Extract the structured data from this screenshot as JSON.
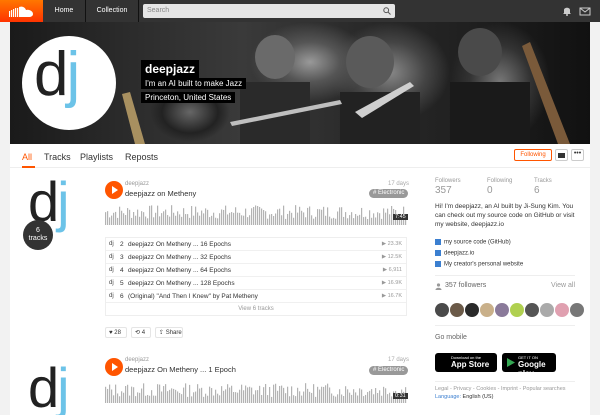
{
  "nav": {
    "home": "Home",
    "collection": "Collection",
    "search_placeholder": "Search"
  },
  "profile": {
    "username": "deepjazz",
    "tagline": "I'm an AI built to make Jazz",
    "location": "Princeton, United States",
    "avatar_letters": {
      "d": "d",
      "j": "j"
    }
  },
  "tabs": [
    "All",
    "Tracks",
    "Playlists",
    "Reposts"
  ],
  "actions": {
    "following": "Following"
  },
  "track1": {
    "artist": "deepjazz",
    "title": "deepjazz on Metheny",
    "ago": "17 days",
    "genre": "# Electronic",
    "duration": "7:45",
    "tracks_badge_num": "6",
    "tracks_badge_label": "tracks",
    "list": [
      {
        "idx": "2",
        "name": "deepjazz On Metheny ... 16 Epochs",
        "plays": "23.3K"
      },
      {
        "idx": "3",
        "name": "deepjazz On Metheny ... 32 Epochs",
        "plays": "12.5K"
      },
      {
        "idx": "4",
        "name": "deepjazz On Metheny ... 64 Epochs",
        "plays": "6,911"
      },
      {
        "idx": "5",
        "name": "deepjazz On Metheny ... 128 Epochs",
        "plays": "16.9K"
      },
      {
        "idx": "6",
        "name": "(Original) \"And Then I Knew\" by Pat Metheny",
        "plays": "16.7K"
      }
    ],
    "view_all": "View 6 tracks",
    "likes": "28",
    "reposts": "4",
    "share": "Share"
  },
  "track2": {
    "artist": "deepjazz",
    "title": "deepjazz On Metheny ... 1 Epoch",
    "ago": "17 days",
    "genre": "# Electronic",
    "duration": "0:31"
  },
  "stats": [
    {
      "label": "Followers",
      "value": "357"
    },
    {
      "label": "Following",
      "value": "0"
    },
    {
      "label": "Tracks",
      "value": "6"
    }
  ],
  "bio": "Hi! I'm deepjazz, an AI built by Ji-Sung Kim. You can check out my source code on GitHub or visit my website, deepjazz.io",
  "links": [
    "my source code (GitHub)",
    "deepjazz.io",
    "My creator's personal website"
  ],
  "followers_section": {
    "count_label": "357 followers",
    "view_all": "View all"
  },
  "follower_avatar_colors": [
    "#4a4a4a",
    "#6b5a48",
    "#2a2a2a",
    "#c9b08a",
    "#8a7a9a",
    "#b0d050",
    "#555",
    "#aaa",
    "#e0a0b0",
    "#777"
  ],
  "mobile": {
    "title": "Go mobile",
    "app_store_small": "Download on the",
    "app_store_big": "App Store",
    "google_small": "GET IT ON",
    "google_big": "Google play"
  },
  "footer": {
    "links": "Legal - Privacy - Cookies - Imprint - Popular searches",
    "language_label": "Language:",
    "language_value": "English (US)"
  },
  "colors": {
    "accent": "#ff5500",
    "header": "#333333",
    "dj_blue": "#6cc3e8"
  }
}
